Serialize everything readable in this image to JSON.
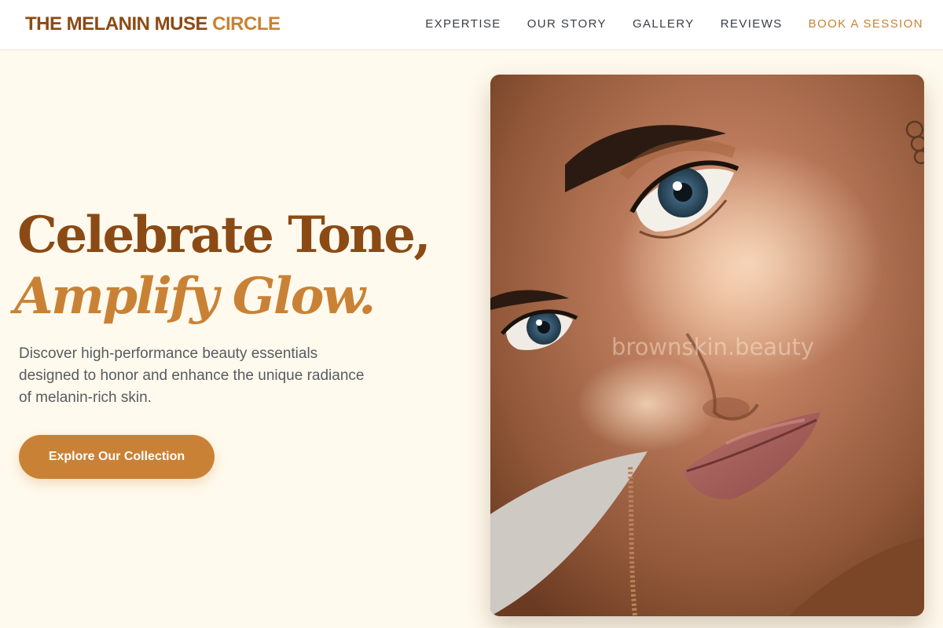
{
  "brand": {
    "name_main": "THE MELANIN MUSE",
    "name_accent": "CIRCLE"
  },
  "nav": {
    "items": [
      {
        "label": "EXPERTISE"
      },
      {
        "label": "OUR STORY"
      },
      {
        "label": "GALLERY"
      },
      {
        "label": "REVIEWS"
      },
      {
        "label": "BOOK A SESSION"
      }
    ]
  },
  "hero": {
    "headline_line1": "Celebrate Tone,",
    "headline_line2": "Amplify Glow.",
    "description": "Discover high-performance beauty essentials designed to honor and enhance the unique radiance of melanin-rich skin.",
    "cta_label": "Explore Our Collection",
    "image_watermark": "brownskin.beauty"
  },
  "colors": {
    "page_background": "#fffaed",
    "brand_dark": "#8b4a14",
    "brand_accent": "#c98235",
    "nav_text": "#3a3d44",
    "body_text": "#575b62"
  }
}
